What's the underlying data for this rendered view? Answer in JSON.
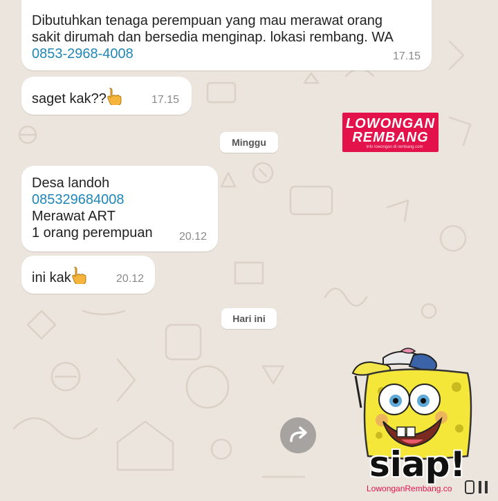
{
  "messages": [
    {
      "lines": [
        "Dibutuhkan tenaga perempuan yang mau merawat orang",
        "sakit dirumah dan bersedia menginap. lokasi rembang. WA"
      ],
      "link": "0853-2968-4008",
      "time": "17.15"
    },
    {
      "text": "saget kak??",
      "time": "17.15",
      "icon": "pointing-hand-icon"
    },
    {
      "line1": "Desa landoh",
      "link": "085329684008",
      "line3": "Merawat ART",
      "line4": "1 orang perempuan",
      "time": "20.12"
    },
    {
      "text": "ini kak",
      "time": "20.12",
      "icon": "pointing-hand-icon"
    }
  ],
  "date_chips": {
    "first": "Minggu",
    "second": "Hari ini"
  },
  "logo": {
    "line1": "LOWONGAN",
    "line2": "REMBANG",
    "tagline": "Info lowongan di rembang.com"
  },
  "sticker": {
    "caption": "siap!",
    "watermark": "LowonganRembang.co"
  },
  "colors": {
    "link": "#1f86b5",
    "logo_bg": "#e3124b",
    "wallpaper": "#ece5dd"
  },
  "icons": {
    "forward": "forward-arrow-icon",
    "pause": "pause-icon"
  }
}
